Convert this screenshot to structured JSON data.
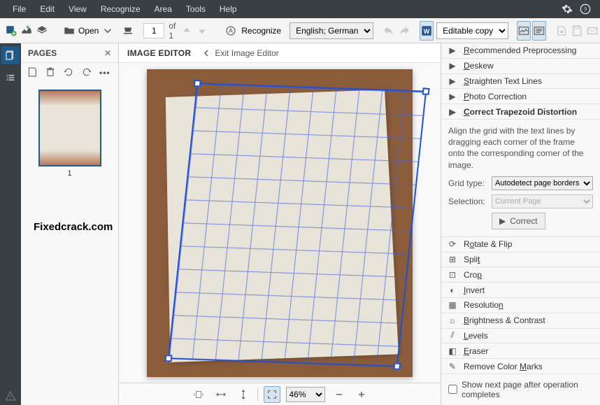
{
  "menu": {
    "file": "File",
    "edit": "Edit",
    "view": "View",
    "recognize": "Recognize",
    "area": "Area",
    "tools": "Tools",
    "help": "Help"
  },
  "toolbar": {
    "open_label": "Open",
    "page_value": "1",
    "page_of": "of 1",
    "recognize_label": "Recognize",
    "language": "English; German",
    "editable_copy": "Editable copy"
  },
  "pages": {
    "title": "PAGES",
    "thumb_label": "1"
  },
  "editor": {
    "title": "IMAGE EDITOR",
    "exit": "Exit Image Editor"
  },
  "zoom": {
    "value": "46%"
  },
  "rightpanel": {
    "items": [
      {
        "label": "Recommended Preprocessing",
        "u": "R"
      },
      {
        "label": "Deskew",
        "u": "D"
      },
      {
        "label": "Straighten Text Lines",
        "u": "S"
      },
      {
        "label": "Photo Correction",
        "u": "P"
      },
      {
        "label": "Correct Trapezoid Distortion",
        "u": "C",
        "expanded": true
      },
      {
        "label": "Rotate & Flip",
        "u": "o"
      },
      {
        "label": "Split",
        "u": "t"
      },
      {
        "label": "Crop",
        "u": "p"
      },
      {
        "label": "Invert",
        "u": "I"
      },
      {
        "label": "Resolution",
        "u": "n"
      },
      {
        "label": "Brightness & Contrast",
        "u": "B"
      },
      {
        "label": "Levels",
        "u": "L"
      },
      {
        "label": "Eraser",
        "u": "E"
      },
      {
        "label": "Remove Color Marks",
        "u": "M"
      }
    ],
    "trapezoid": {
      "hint": "Align the grid with the text lines by dragging each corner of the frame onto the corresponding corner of the image.",
      "grid_label": "Grid type:",
      "grid_value": "Autodetect page borders",
      "sel_label": "Selection:",
      "sel_value": "Current Page",
      "correct_btn": "Correct"
    },
    "checkbox": "Show next page after operation completes"
  },
  "watermark": "Fixedcrack.com"
}
